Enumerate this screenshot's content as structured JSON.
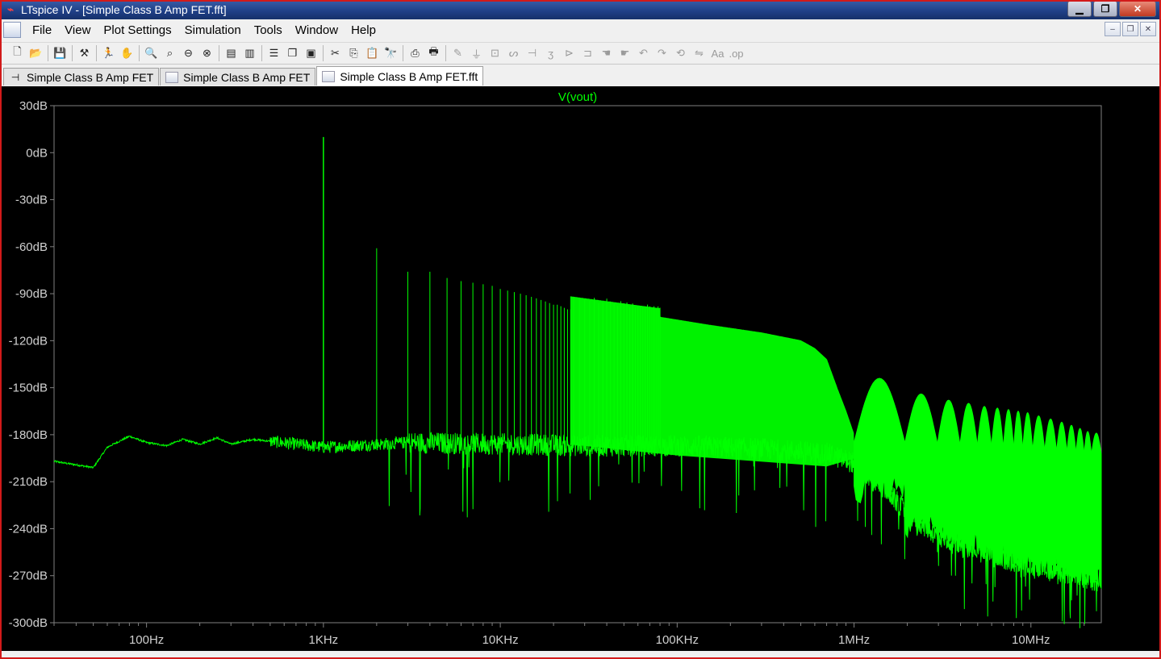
{
  "window": {
    "title": "LTspice IV - [Simple Class B Amp FET.fft]"
  },
  "menu": [
    "File",
    "View",
    "Plot Settings",
    "Simulation",
    "Tools",
    "Window",
    "Help"
  ],
  "tabs": [
    {
      "label": "Simple Class B Amp FET",
      "icon": "schematic-icon",
      "active": false
    },
    {
      "label": "Simple Class B Amp FET",
      "icon": "waveform-icon",
      "active": false
    },
    {
      "label": "Simple Class B Amp FET.fft",
      "icon": "waveform-icon",
      "active": true
    }
  ],
  "toolbar": [
    {
      "name": "new-schematic",
      "icon": "new-schematic-icon",
      "glyph": "🗋",
      "dim": false
    },
    {
      "name": "open",
      "icon": "open-folder-icon",
      "glyph": "📂",
      "dim": false
    },
    {
      "sep": true
    },
    {
      "name": "save",
      "icon": "save-icon",
      "glyph": "💾",
      "dim": false
    },
    {
      "sep": true
    },
    {
      "name": "control-panel",
      "icon": "hammer-icon",
      "glyph": "⚒",
      "dim": false
    },
    {
      "sep": true
    },
    {
      "name": "run",
      "icon": "run-icon",
      "glyph": "🏃",
      "dim": true
    },
    {
      "name": "halt",
      "icon": "hand-icon",
      "glyph": "✋",
      "dim": true
    },
    {
      "sep": true
    },
    {
      "name": "zoom-area",
      "icon": "zoom-in-icon",
      "glyph": "🔍",
      "dim": false
    },
    {
      "name": "pan",
      "icon": "magnify-icon",
      "glyph": "⌕",
      "dim": false
    },
    {
      "name": "zoom-out",
      "icon": "zoom-out-icon",
      "glyph": "⊖",
      "dim": false
    },
    {
      "name": "zoom-full",
      "icon": "zoom-cancel-icon",
      "glyph": "⊗",
      "dim": false
    },
    {
      "sep": true
    },
    {
      "name": "autorange",
      "icon": "autorange-icon",
      "glyph": "▤",
      "dim": false
    },
    {
      "name": "mark-unused",
      "icon": "chart-icon",
      "glyph": "▥",
      "dim": false
    },
    {
      "sep": true
    },
    {
      "name": "tile-horizontal",
      "icon": "tile-horizontal-icon",
      "glyph": "☰",
      "dim": false
    },
    {
      "name": "cascade",
      "icon": "cascade-icon",
      "glyph": "❐",
      "dim": false
    },
    {
      "name": "tile-vertical",
      "icon": "tile-vertical-icon",
      "glyph": "▣",
      "dim": false
    },
    {
      "sep": true
    },
    {
      "name": "cut",
      "icon": "scissors-icon",
      "glyph": "✂",
      "dim": false
    },
    {
      "name": "copy",
      "icon": "copy-icon",
      "glyph": "⎘",
      "dim": false
    },
    {
      "name": "paste",
      "icon": "paste-icon",
      "glyph": "📋",
      "dim": false
    },
    {
      "name": "find",
      "icon": "binoculars-icon",
      "glyph": "🔭",
      "dim": false
    },
    {
      "sep": true
    },
    {
      "name": "print-preview",
      "icon": "print-preview-icon",
      "glyph": "⎙",
      "dim": false
    },
    {
      "name": "print",
      "icon": "print-icon",
      "glyph": "🖶",
      "dim": false
    },
    {
      "sep": true
    },
    {
      "name": "wire",
      "icon": "pencil-icon",
      "glyph": "✎",
      "dim": true
    },
    {
      "name": "ground",
      "icon": "ground-icon",
      "glyph": "⏚",
      "dim": true
    },
    {
      "name": "label",
      "icon": "label-icon",
      "glyph": "⊡",
      "dim": true
    },
    {
      "name": "resistor",
      "icon": "resistor-icon",
      "glyph": "ᔕ",
      "dim": true
    },
    {
      "name": "capacitor",
      "icon": "capacitor-icon",
      "glyph": "⊣",
      "dim": true
    },
    {
      "name": "inductor",
      "icon": "inductor-icon",
      "glyph": "ʒ",
      "dim": true
    },
    {
      "name": "diode",
      "icon": "diode-icon",
      "glyph": "⊳",
      "dim": true
    },
    {
      "name": "component",
      "icon": "component-icon",
      "glyph": "⊐",
      "dim": true
    },
    {
      "name": "move",
      "icon": "hand-move-icon",
      "glyph": "☚",
      "dim": true
    },
    {
      "name": "drag",
      "icon": "hand-drag-icon",
      "glyph": "☛",
      "dim": true
    },
    {
      "name": "undo",
      "icon": "undo-icon",
      "glyph": "↶",
      "dim": true
    },
    {
      "name": "redo",
      "icon": "redo-icon",
      "glyph": "↷",
      "dim": true
    },
    {
      "name": "rotate",
      "icon": "rotate-icon",
      "glyph": "⟲",
      "dim": true
    },
    {
      "name": "mirror",
      "icon": "mirror-icon",
      "glyph": "⇋",
      "dim": true
    },
    {
      "name": "text",
      "icon": "text-icon",
      "glyph": "Aa",
      "dim": true
    },
    {
      "name": "spice-directive",
      "icon": "spice-directive-icon",
      "glyph": ".op",
      "dim": true
    }
  ],
  "chart_data": {
    "type": "line",
    "title": "V(vout)",
    "color": "#00ff00",
    "x_scale": "log",
    "x_unit": "Hz",
    "xlim": [
      30,
      25000000
    ],
    "ylim": [
      -300,
      30
    ],
    "x_ticks": [
      {
        "value": 100,
        "label": "100Hz"
      },
      {
        "value": 1000,
        "label": "1KHz"
      },
      {
        "value": 10000,
        "label": "10KHz"
      },
      {
        "value": 100000,
        "label": "100KHz"
      },
      {
        "value": 1000000,
        "label": "1MHz"
      },
      {
        "value": 10000000,
        "label": "10MHz"
      }
    ],
    "y_ticks": [
      {
        "value": 30,
        "label": "30dB"
      },
      {
        "value": 0,
        "label": "0dB"
      },
      {
        "value": -30,
        "label": "-30dB"
      },
      {
        "value": -60,
        "label": "-60dB"
      },
      {
        "value": -90,
        "label": "-90dB"
      },
      {
        "value": -120,
        "label": "-120dB"
      },
      {
        "value": -150,
        "label": "-150dB"
      },
      {
        "value": -180,
        "label": "-180dB"
      },
      {
        "value": -210,
        "label": "-210dB"
      },
      {
        "value": -240,
        "label": "-240dB"
      },
      {
        "value": -270,
        "label": "-270dB"
      },
      {
        "value": -300,
        "label": "-300dB"
      }
    ],
    "fundamental": {
      "freq": 1000,
      "db": 10
    },
    "harmonics_db": [
      -61,
      -76,
      -76,
      -80,
      -82,
      -83,
      -84,
      -85,
      -87,
      -88,
      -89,
      -90,
      -91,
      -92,
      -93,
      -94,
      -95,
      -96,
      -97,
      -97,
      -98,
      -99,
      -100,
      -100
    ],
    "noise_floor_db": [
      [
        30,
        -197
      ],
      [
        50,
        -201
      ],
      [
        60,
        -188
      ],
      [
        80,
        -181
      ],
      [
        100,
        -185
      ],
      [
        130,
        -187
      ],
      [
        160,
        -183
      ],
      [
        200,
        -186
      ],
      [
        250,
        -182
      ],
      [
        300,
        -186
      ],
      [
        400,
        -183
      ],
      [
        700,
        -186
      ],
      [
        1000,
        -188
      ],
      [
        3000,
        -185
      ],
      [
        10000,
        -186
      ],
      [
        30000,
        -187
      ],
      [
        100000,
        -187
      ],
      [
        300000,
        -189
      ],
      [
        700000,
        -192
      ],
      [
        1000000,
        -198
      ],
      [
        1500000,
        -215
      ],
      [
        2000000,
        -230
      ],
      [
        3000000,
        -245
      ],
      [
        5000000,
        -252
      ],
      [
        10000000,
        -262
      ],
      [
        25000000,
        -272
      ]
    ],
    "envelope_db": [
      [
        80000,
        -105
      ],
      [
        150000,
        -110
      ],
      [
        300000,
        -115
      ],
      [
        500000,
        -120
      ],
      [
        600000,
        -125
      ],
      [
        700000,
        -132
      ],
      [
        800000,
        -150
      ],
      [
        900000,
        -165
      ],
      [
        1000000,
        -180
      ]
    ],
    "lobe_peaks_db": [
      [
        1500000,
        -144
      ],
      [
        2500000,
        -154
      ],
      [
        3500000,
        -158
      ],
      [
        4500000,
        -160
      ],
      [
        5500000,
        -162
      ],
      [
        6500000,
        -163
      ],
      [
        7500000,
        -164
      ],
      [
        8500000,
        -165
      ],
      [
        9500000,
        -166
      ],
      [
        11000000,
        -168
      ],
      [
        13000000,
        -170
      ],
      [
        15000000,
        -172
      ],
      [
        17000000,
        -174
      ],
      [
        19000000,
        -176
      ],
      [
        21000000,
        -178
      ],
      [
        23000000,
        -179
      ]
    ]
  }
}
